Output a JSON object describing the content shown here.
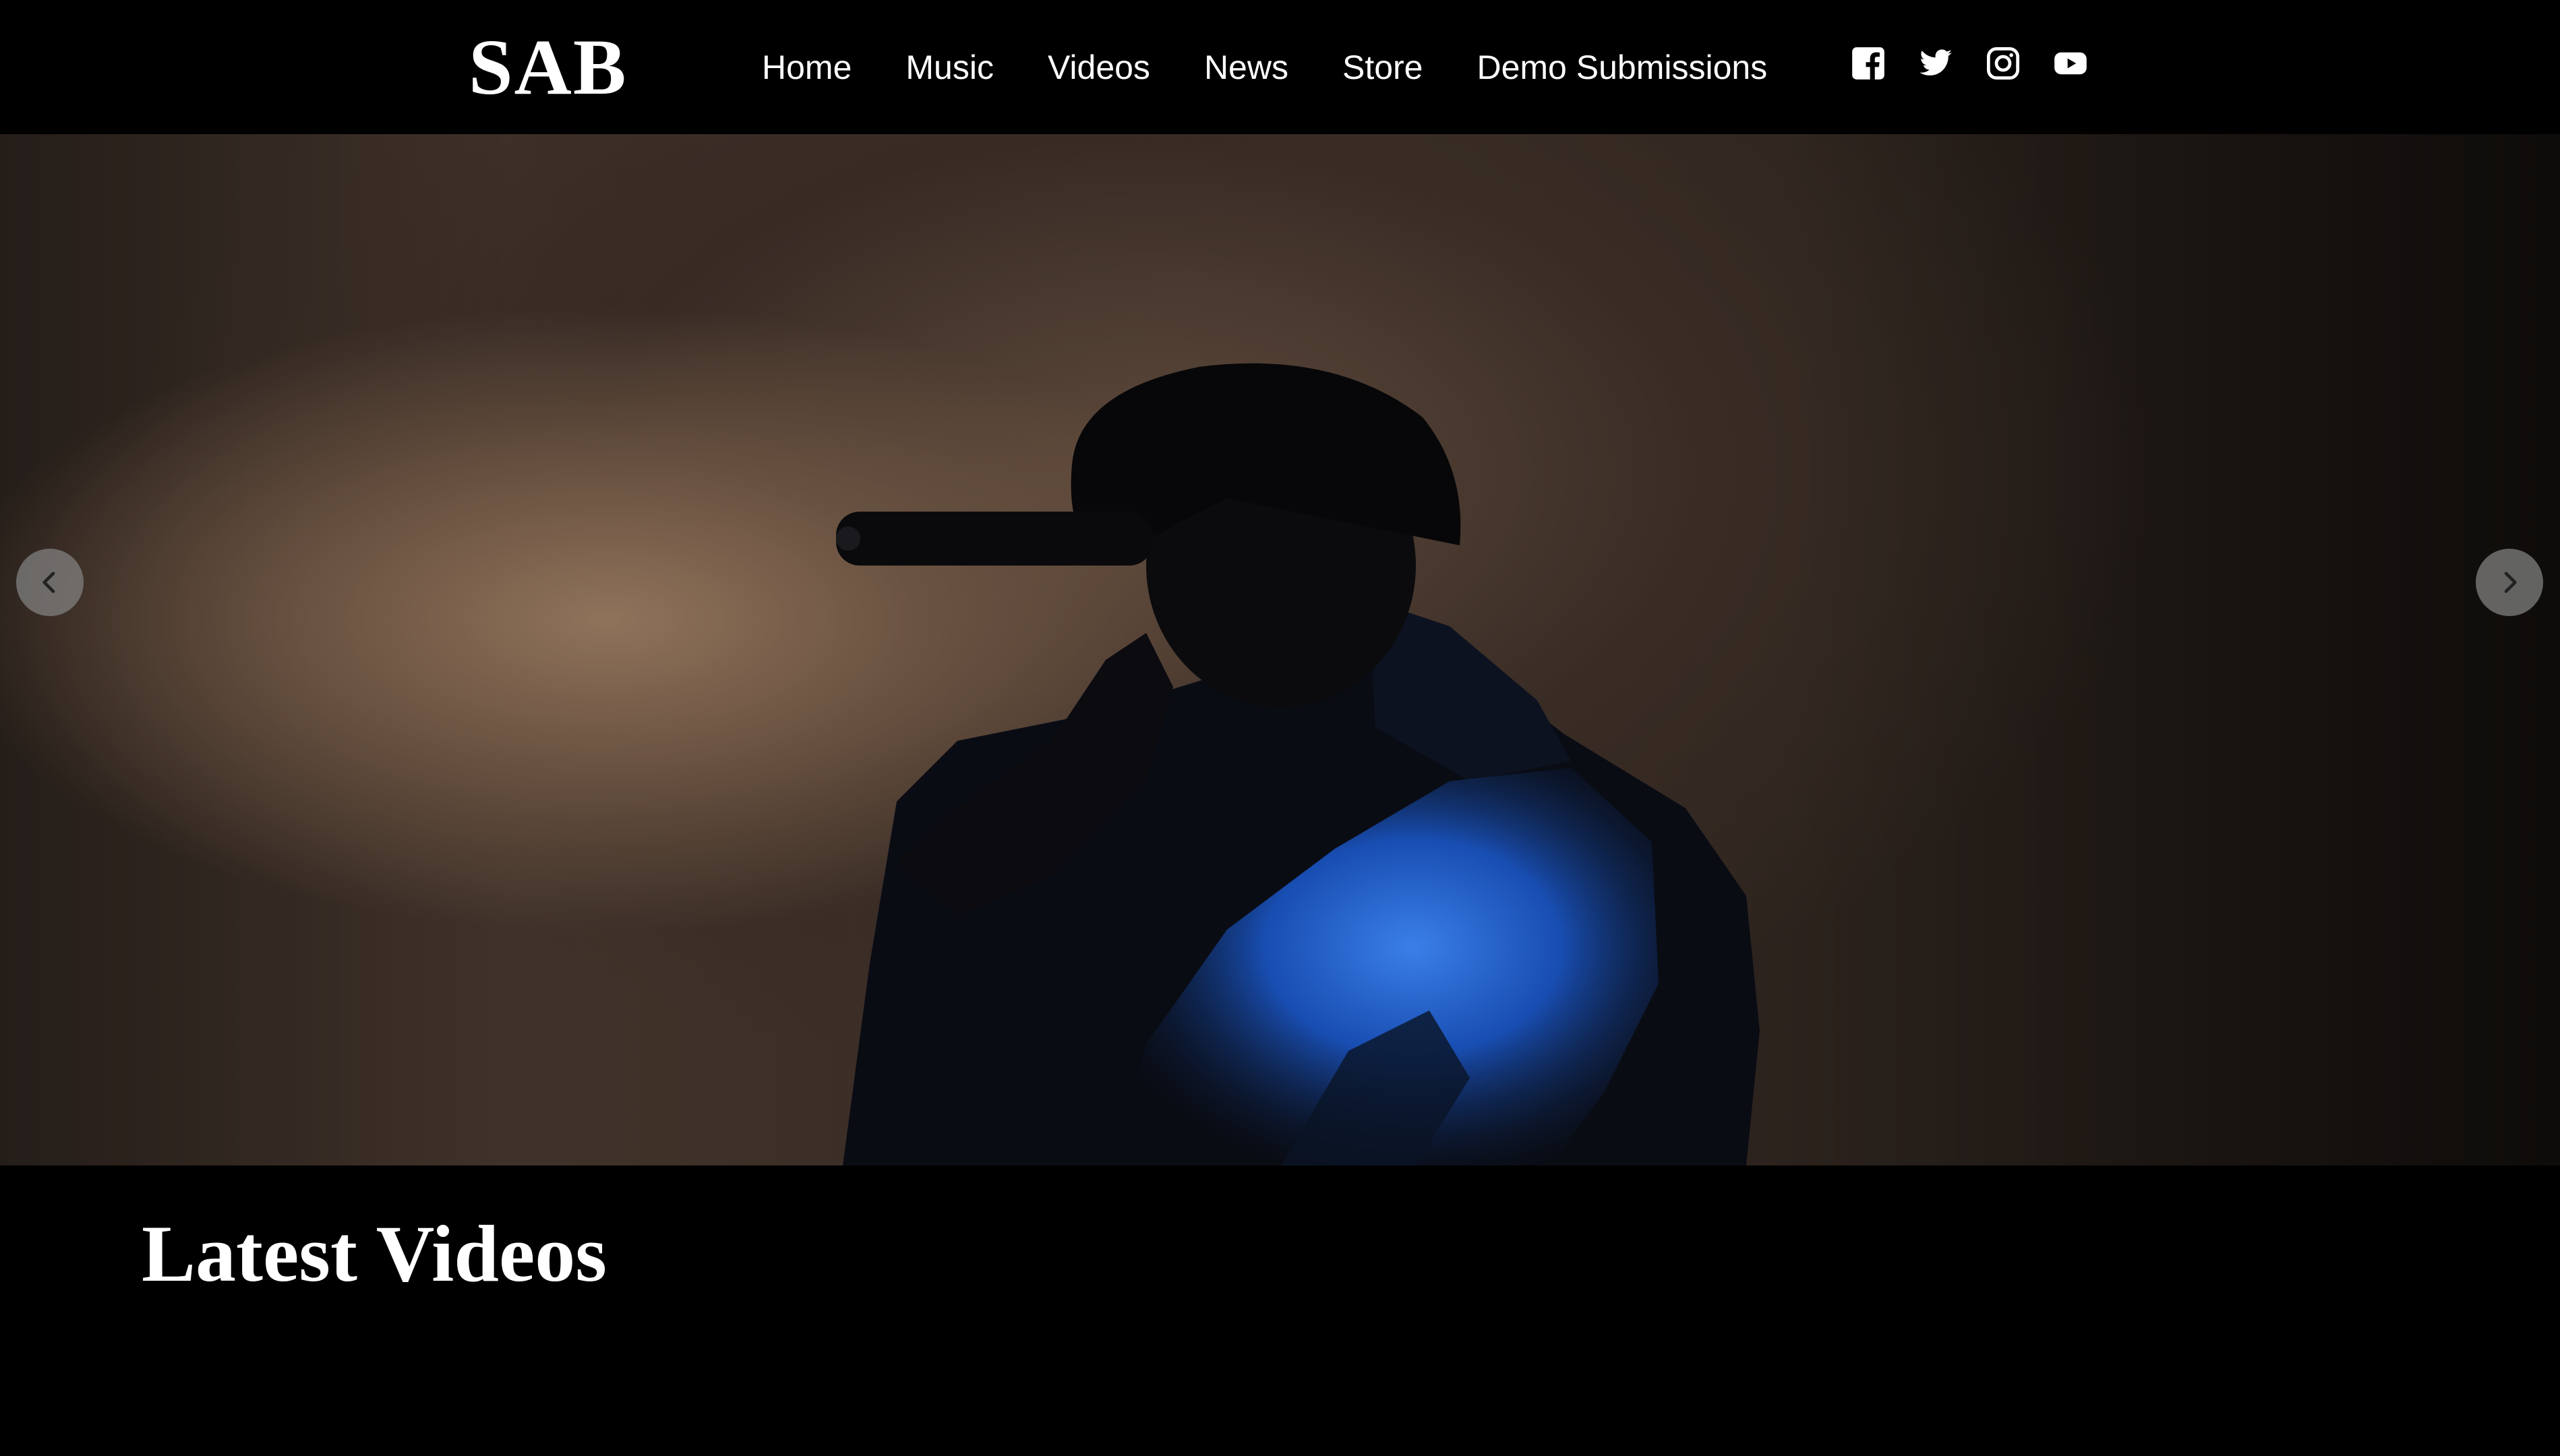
{
  "header": {
    "logo": "SAB",
    "nav": [
      {
        "label": "Home"
      },
      {
        "label": "Music"
      },
      {
        "label": "Videos"
      },
      {
        "label": "News"
      },
      {
        "label": "Store"
      },
      {
        "label": "Demo Submissions"
      }
    ],
    "social": [
      {
        "icon": "facebook-icon"
      },
      {
        "icon": "twitter-icon"
      },
      {
        "icon": "instagram-icon"
      },
      {
        "icon": "youtube-icon"
      }
    ]
  },
  "hero": {
    "image": "performer-with-microphone-photo",
    "prev_icon": "chevron-left-icon",
    "next_icon": "chevron-right-icon"
  },
  "sections": {
    "latest_videos_title": "Latest Videos"
  },
  "colors": {
    "background": "#000000",
    "text": "#ffffff",
    "jacket_accent": "#2a6fd6"
  }
}
